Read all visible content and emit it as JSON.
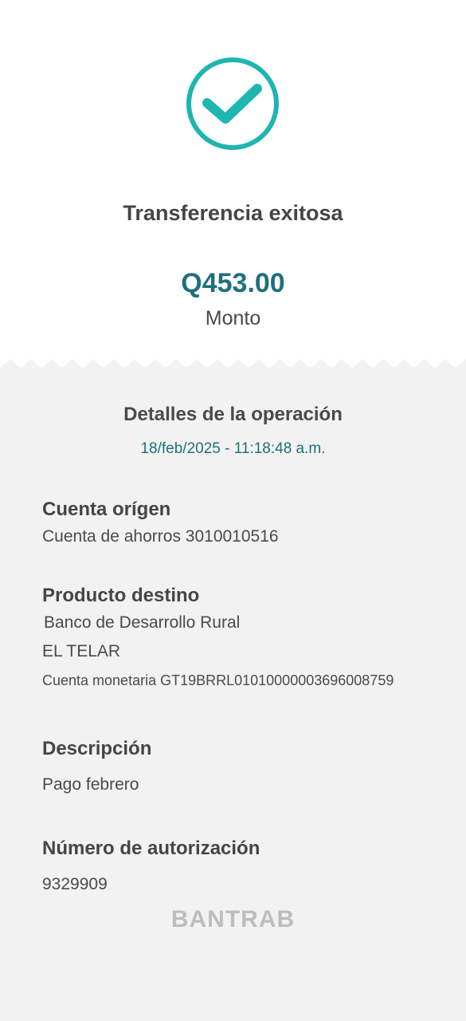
{
  "status": {
    "icon": "check-circle-icon",
    "title": "Transferencia exitosa",
    "accent_color": "#1fb5b0"
  },
  "amount": {
    "value": "Q453.00",
    "label": "Monto",
    "color": "#1e6f7d"
  },
  "details": {
    "title": "Detalles de la operación",
    "datetime": "18/feb/2025 - 11:18:48 a.m.",
    "origin": {
      "label": "Cuenta orígen",
      "value": "Cuenta de ahorros 3010010516"
    },
    "destination": {
      "label": "Producto destino",
      "bank": "Banco de Desarrollo Rural",
      "name": "EL TELAR",
      "account": "Cuenta monetaria GT19BRRL01010000003696008759"
    },
    "description": {
      "label": "Descripción",
      "value": "Pago febrero"
    },
    "authorization": {
      "label": "Número de autorización",
      "value": "9329909"
    }
  },
  "brand": "BANTRAB"
}
